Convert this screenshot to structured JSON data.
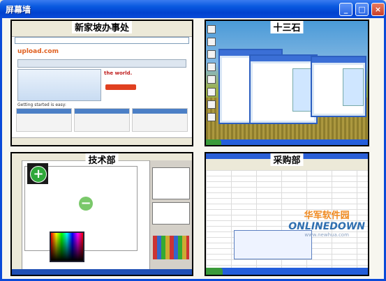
{
  "window": {
    "title": "屏幕墙",
    "controls": {
      "minimize": "_",
      "maximize": "□",
      "close": "×"
    }
  },
  "panels": [
    {
      "label": "新家坡办事处",
      "content": "browser"
    },
    {
      "label": "十三石",
      "content": "chat"
    },
    {
      "label": "技术部",
      "content": "graphics"
    },
    {
      "label": "采购部",
      "content": "spreadsheet"
    }
  ],
  "browser": {
    "logo": "upload.com",
    "hero_text": "the world.",
    "getting_started": "Getting started is easy:"
  },
  "graphics": {
    "plus_icon": "+",
    "minus_icon": "−"
  },
  "watermark": {
    "cn": "华军软件园",
    "en": "ONLINEDOWN",
    "url": "www.newhua.com"
  }
}
